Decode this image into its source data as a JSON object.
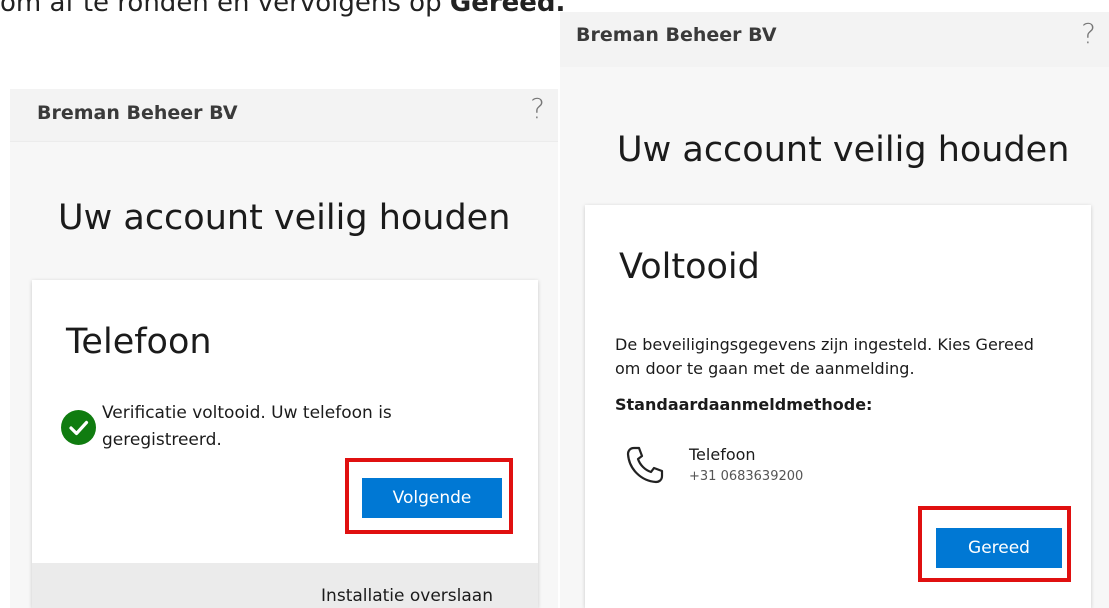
{
  "caption": {
    "prefix": "om af te ronden en vervolgens op ",
    "bold": "Gereed."
  },
  "left": {
    "org_name": "Breman Beheer BV",
    "help_glyph": "?",
    "page_title": "Uw account veilig houden",
    "card_heading": "Telefoon",
    "verify_text": "Verificatie voltooid. Uw telefoon is geregistreerd.",
    "next_button": "Volgende",
    "skip_link": "Installatie overslaan"
  },
  "right": {
    "org_name": "Breman Beheer BV",
    "help_glyph": "?",
    "page_title": "Uw account veilig houden",
    "card_heading": "Voltooid",
    "description": "De beveiligingsgegevens zijn ingesteld. Kies Gereed om door te gaan met de aanmelding.",
    "method_label": "Standaardaanmeldmethode:",
    "method_name": "Telefoon",
    "method_number": "+31 0683639200",
    "done_button": "Gereed"
  },
  "colors": {
    "primary_button": "#0078d4",
    "success_check": "#107c10",
    "highlight_border": "#e01010"
  },
  "icons": {
    "help": "help-icon",
    "check": "checkmark-circle-icon",
    "phone": "phone-icon"
  }
}
